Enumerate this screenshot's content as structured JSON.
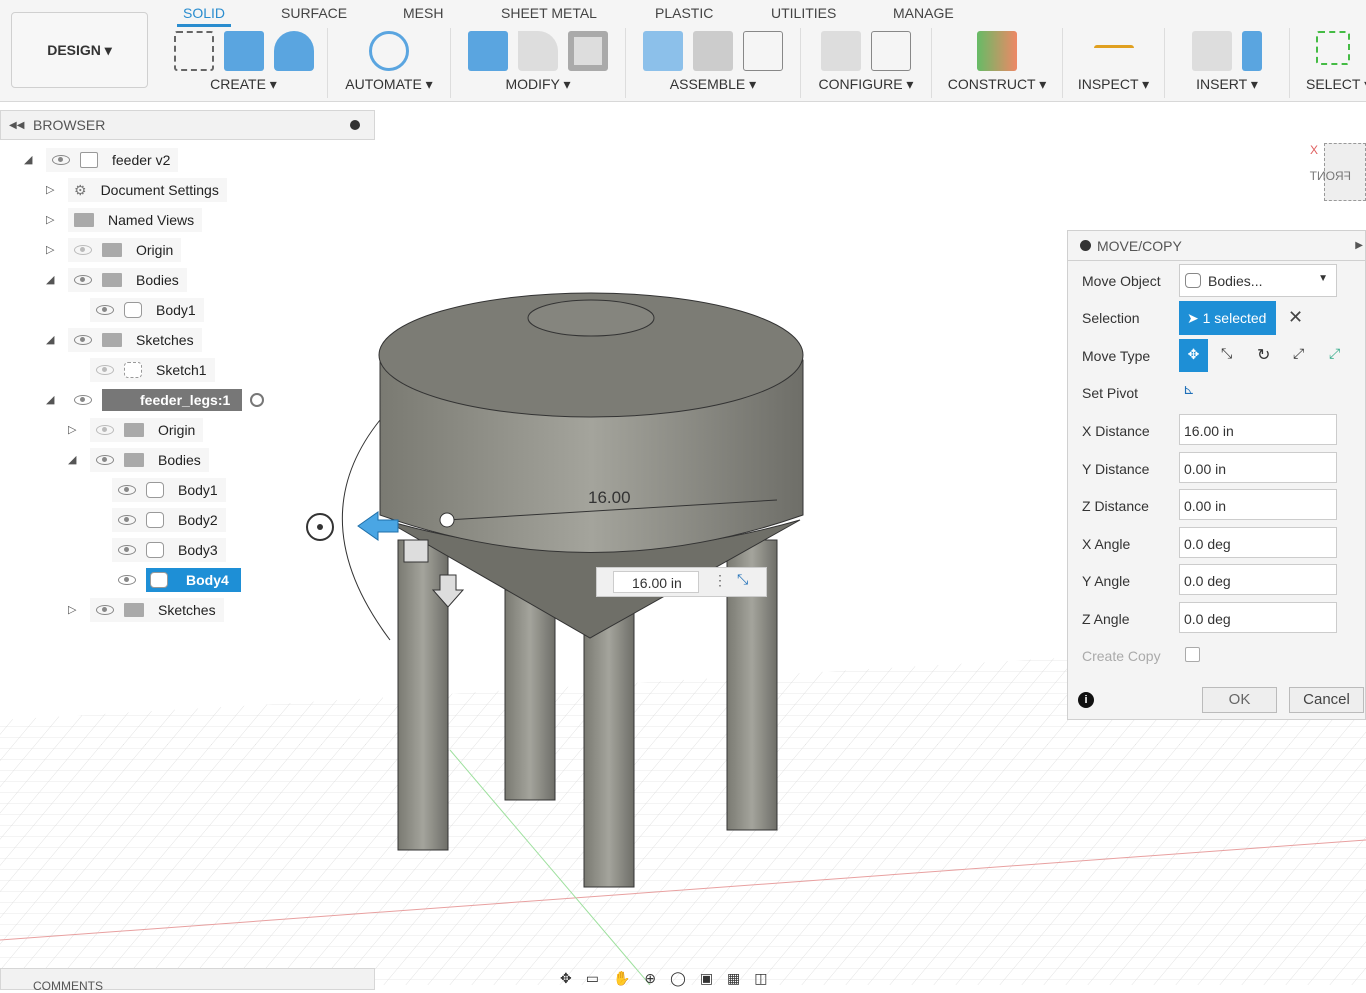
{
  "toolbar": {
    "workspace": "DESIGN ▾",
    "tabs": [
      "SOLID",
      "SURFACE",
      "MESH",
      "SHEET METAL",
      "PLASTIC",
      "UTILITIES",
      "MANAGE"
    ],
    "groups": [
      "CREATE ▾",
      "AUTOMATE ▾",
      "MODIFY ▾",
      "ASSEMBLE ▾",
      "CONFIGURE ▾",
      "CONSTRUCT ▾",
      "INSPECT ▾",
      "INSERT ▾",
      "SELECT ▾"
    ]
  },
  "browser": {
    "title": "BROWSER",
    "items": [
      "feeder v2",
      "Document Settings",
      "Named Views",
      "Origin",
      "Bodies",
      "Body1",
      "Sketches",
      "Sketch1",
      "feeder_legs:1",
      "Origin",
      "Bodies",
      "Body1",
      "Body2",
      "Body3",
      "Body4",
      "Sketches"
    ]
  },
  "viewport": {
    "dimension_label": "16.00",
    "input_value": "16.00 in",
    "viewcube_label": "FRONT",
    "axis_x": "X"
  },
  "panel": {
    "title": "MOVE/COPY",
    "move_object_label": "Move Object",
    "move_object_value": "Bodies...",
    "selection_label": "Selection",
    "selection_value": "1 selected",
    "move_type_label": "Move Type",
    "set_pivot_label": "Set Pivot",
    "fields": [
      {
        "label": "X Distance",
        "value": "16.00 in"
      },
      {
        "label": "Y Distance",
        "value": "0.00 in"
      },
      {
        "label": "Z Distance",
        "value": "0.00 in"
      },
      {
        "label": "X Angle",
        "value": "0.0 deg"
      },
      {
        "label": "Y Angle",
        "value": "0.0 deg"
      },
      {
        "label": "Z Angle",
        "value": "0.0 deg"
      }
    ],
    "create_copy_label": "Create Copy",
    "ok": "OK",
    "cancel": "Cancel"
  },
  "comments": {
    "title": "COMMENTS"
  },
  "colors": {
    "accent": "#1e8fd6",
    "body": "#8a8a82"
  }
}
